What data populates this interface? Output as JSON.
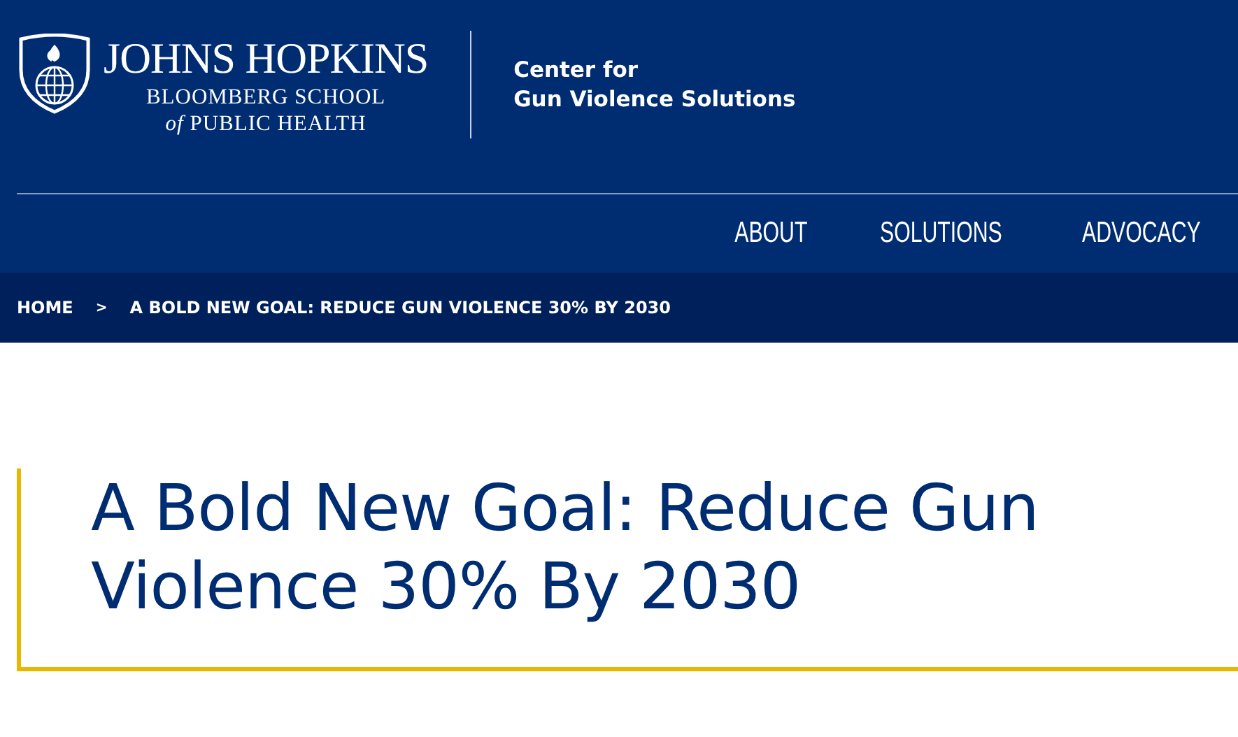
{
  "header": {
    "logo": {
      "name": "JOHNS HOPKINS",
      "line_2": "BLOOMBERG SCHOOL",
      "line_3": "*of* PUBLIC HEALTH"
    },
    "center_name": [
      "Center for",
      "Gun Violence Solutions"
    ]
  },
  "nav": [
    {
      "label": "ABOUT"
    },
    {
      "label": "SOLUTIONS"
    },
    {
      "label": "ADVOCACY"
    }
  ],
  "breadcrumb": [
    {
      "label": "HOME"
    },
    {
      "label": ">",
      "kind": "separator"
    },
    {
      "label": "A BOLD NEW GOAL: REDUCE GUN VIOLENCE 30% BY 2030"
    }
  ],
  "title": "A Bold New Goal: Reduce Gun Violence 30% By 2030"
}
